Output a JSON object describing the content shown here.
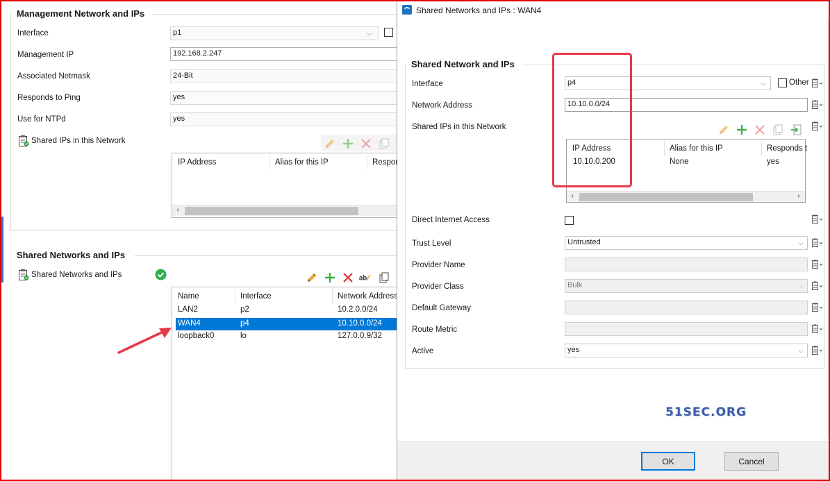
{
  "management": {
    "title": "Management Network and IPs",
    "labels": {
      "interface": "Interface",
      "management_ip": "Management IP",
      "netmask": "Associated Netmask",
      "ping": "Responds to Ping",
      "ntp": "Use for NTPd",
      "shared_ips": "Shared IPs in this Network"
    },
    "values": {
      "interface": "p1",
      "management_ip": "192.168.2.247",
      "netmask": "24-Bit",
      "ping": "yes",
      "ntp": "yes"
    },
    "ip_table": {
      "columns": [
        "IP Address",
        "Alias for this IP",
        "Respor"
      ]
    }
  },
  "shared": {
    "title": "Shared Networks and IPs",
    "label": "Shared Networks and IPs",
    "columns": [
      "Name",
      "Interface",
      "Network Address"
    ],
    "rows": [
      {
        "name": "LAN2",
        "interface": "p2",
        "network": "10.2.0.0/24"
      },
      {
        "name": "WAN4",
        "interface": "p4",
        "network": "10.10.0.0/24"
      },
      {
        "name": "loopback0",
        "interface": "lo",
        "network": "127.0.0.9/32"
      }
    ],
    "selected_row": "WAN4"
  },
  "dialog": {
    "title": "Shared Networks and IPs : WAN4",
    "group_title": "Shared Network and IPs",
    "labels": {
      "interface": "Interface",
      "network_address": "Network Address",
      "shared_ips": "Shared IPs in this Network",
      "direct_internet": "Direct Internet Access",
      "trust_level": "Trust Level",
      "provider_name": "Provider Name",
      "provider_class": "Provider Class",
      "default_gateway": "Default Gateway",
      "route_metric": "Route Metric",
      "active": "Active",
      "other": "Other"
    },
    "values": {
      "interface": "p4",
      "network_address": "10.10.0.0/24",
      "trust_level": "Untrusted",
      "provider_name": "",
      "provider_class": "Bulk",
      "default_gateway": "",
      "route_metric": "",
      "active": "yes"
    },
    "ip_table": {
      "columns": [
        "IP Address",
        "Alias for this IP",
        "Responds t"
      ],
      "rows": [
        {
          "ip": "10.10.0.200",
          "alias": "None",
          "responds": "yes"
        }
      ]
    },
    "buttons": {
      "ok": "OK",
      "cancel": "Cancel"
    }
  },
  "watermark": "51SEC.ORG",
  "colors": {
    "selection": "#0078d7",
    "annotation": "#e63946",
    "accent_green": "#3cb043",
    "accent_red": "#e03030",
    "pencil_orange": "#f0a030"
  },
  "icons": [
    "pencil-icon",
    "plus-icon",
    "delete-icon",
    "rename-icon",
    "copy-icon",
    "import-icon",
    "clipboard-icon",
    "check-circle-icon",
    "chevron-down-icon"
  ]
}
